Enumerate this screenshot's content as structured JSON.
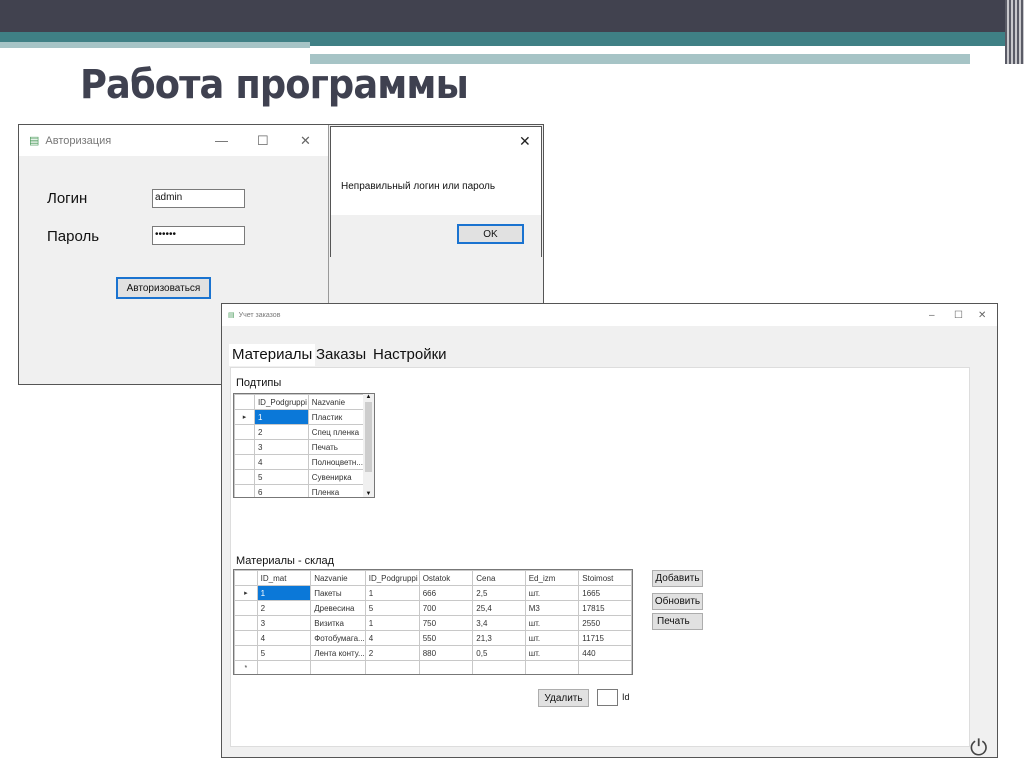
{
  "slide": {
    "title": "Работа программы"
  },
  "login": {
    "title": "Авторизация",
    "login_label": "Логин",
    "login_value": "admin",
    "password_label": "Пароль",
    "password_value": "••••••",
    "submit": "Авторизоваться"
  },
  "msgbox": {
    "text": "Неправильный логин или пароль",
    "ok": "OK"
  },
  "main": {
    "title": "Учет заказов",
    "tabs": [
      "Материалы",
      "Заказы",
      "Настройки"
    ],
    "subtypes": {
      "label": "Подтипы",
      "columns": [
        "ID_Podgruppi",
        "Nazvanie"
      ],
      "rows": [
        [
          "1",
          "Пластик"
        ],
        [
          "2",
          "Спец пленка"
        ],
        [
          "3",
          "Печать"
        ],
        [
          "4",
          "Полноцветн..."
        ],
        [
          "5",
          "Сувенирка"
        ],
        [
          "6",
          "Пленка"
        ]
      ]
    },
    "materials": {
      "label": "Материалы - склад",
      "columns": [
        "ID_mat",
        "Nazvanie",
        "ID_Podgruppi",
        "Ostatok",
        "Cena",
        "Ed_izm",
        "Stoimost"
      ],
      "rows": [
        [
          "1",
          "Пакеты",
          "1",
          "666",
          "2,5",
          "шт.",
          "1665"
        ],
        [
          "2",
          "Древесина",
          "5",
          "700",
          "25,4",
          "М3",
          "17815"
        ],
        [
          "3",
          "Визитка",
          "1",
          "750",
          "3,4",
          "шт.",
          "2550"
        ],
        [
          "4",
          "Фотобумага...",
          "4",
          "550",
          "21,3",
          "шт.",
          "11715"
        ],
        [
          "5",
          "Лента конту...",
          "2",
          "880",
          "0,5",
          "шт.",
          "440"
        ]
      ]
    },
    "buttons": {
      "add": "Добавить",
      "refresh": "Обновить",
      "print": "Печать",
      "delete": "Удалить",
      "id_label": "Id"
    }
  }
}
